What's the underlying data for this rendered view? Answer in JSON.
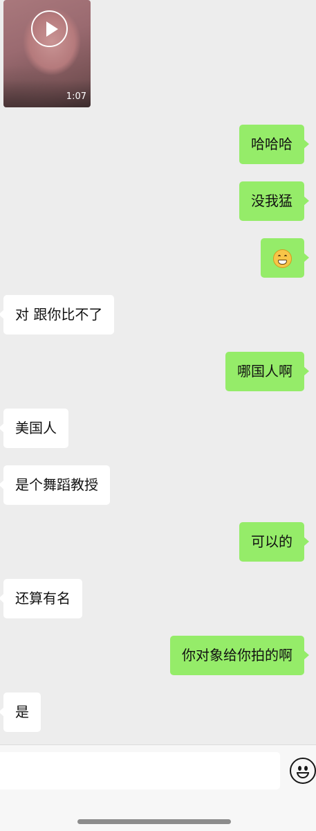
{
  "video_message": {
    "duration": "1:07",
    "icon": "play-icon"
  },
  "messages": [
    {
      "id": "m1",
      "side": "out",
      "text": "哈哈哈"
    },
    {
      "id": "m2",
      "side": "out",
      "text": "没我猛"
    },
    {
      "id": "m3",
      "side": "out",
      "emoji": "grinning-face-emoji"
    },
    {
      "id": "m4",
      "side": "in",
      "text": "对 跟你比不了"
    },
    {
      "id": "m5",
      "side": "out",
      "text": "哪国人啊"
    },
    {
      "id": "m6",
      "side": "in",
      "text": "美国人"
    },
    {
      "id": "m7",
      "side": "in",
      "text": "是个舞蹈教授"
    },
    {
      "id": "m8",
      "side": "out",
      "text": "可以的"
    },
    {
      "id": "m9",
      "side": "in",
      "text": "还算有名"
    },
    {
      "id": "m10",
      "side": "out",
      "text": "你对象给你拍的啊"
    },
    {
      "id": "m11",
      "side": "in",
      "text": "是"
    }
  ],
  "input_bar": {
    "value": "",
    "emoji_icon": "smiley-icon"
  },
  "colors": {
    "outgoing": "#95ec69",
    "incoming": "#ffffff",
    "background": "#ededed"
  }
}
